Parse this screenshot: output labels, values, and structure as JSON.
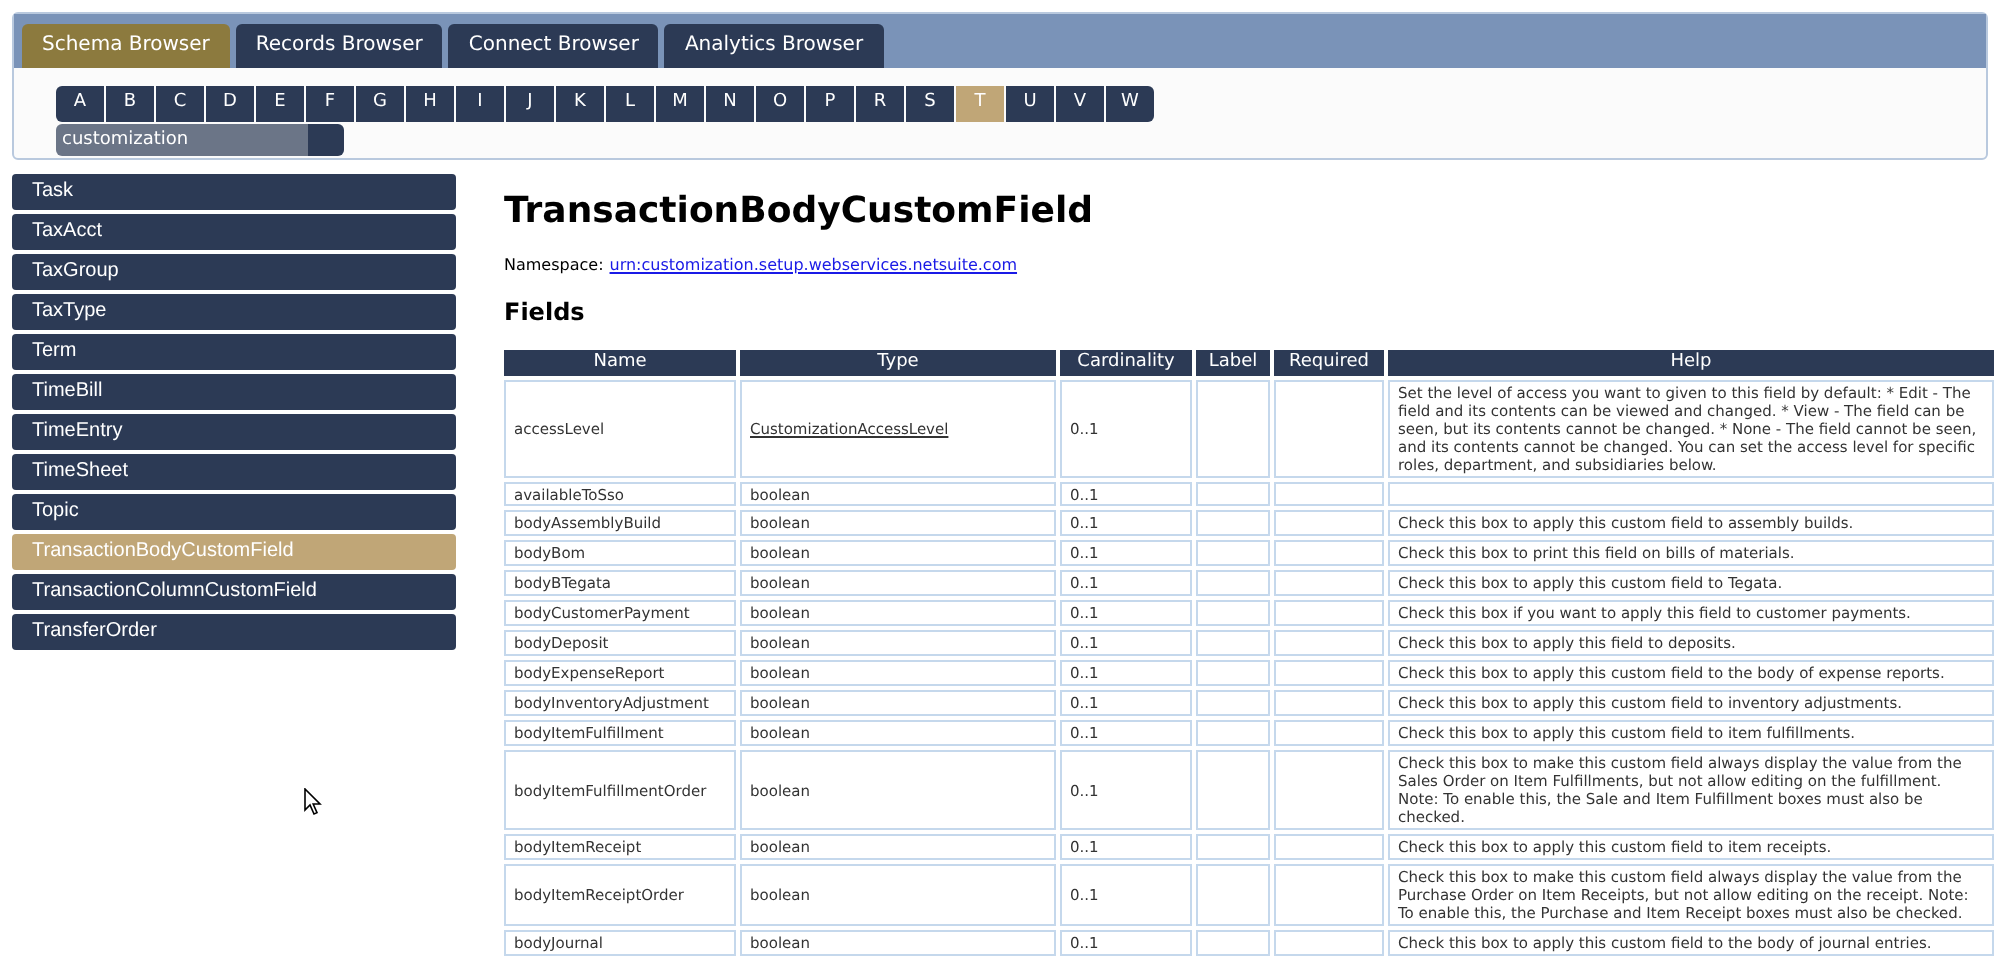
{
  "tabs": [
    {
      "label": "Schema Browser",
      "selected": true
    },
    {
      "label": "Records Browser",
      "selected": false
    },
    {
      "label": "Connect Browser",
      "selected": false
    },
    {
      "label": "Analytics Browser",
      "selected": false
    }
  ],
  "letters": [
    {
      "label": "A",
      "selected": false
    },
    {
      "label": "B",
      "selected": false
    },
    {
      "label": "C",
      "selected": false
    },
    {
      "label": "D",
      "selected": false
    },
    {
      "label": "E",
      "selected": false
    },
    {
      "label": "F",
      "selected": false
    },
    {
      "label": "G",
      "selected": false
    },
    {
      "label": "H",
      "selected": false
    },
    {
      "label": "I",
      "selected": false
    },
    {
      "label": "J",
      "selected": false
    },
    {
      "label": "K",
      "selected": false
    },
    {
      "label": "L",
      "selected": false
    },
    {
      "label": "M",
      "selected": false
    },
    {
      "label": "N",
      "selected": false
    },
    {
      "label": "O",
      "selected": false
    },
    {
      "label": "P",
      "selected": false
    },
    {
      "label": "R",
      "selected": false
    },
    {
      "label": "S",
      "selected": false
    },
    {
      "label": "T",
      "selected": true
    },
    {
      "label": "U",
      "selected": false
    },
    {
      "label": "V",
      "selected": false
    },
    {
      "label": "W",
      "selected": false
    }
  ],
  "namespace_filter": {
    "value": "customization"
  },
  "sidebar": {
    "items": [
      {
        "label": "Task",
        "selected": false
      },
      {
        "label": "TaxAcct",
        "selected": false
      },
      {
        "label": "TaxGroup",
        "selected": false
      },
      {
        "label": "TaxType",
        "selected": false
      },
      {
        "label": "Term",
        "selected": false
      },
      {
        "label": "TimeBill",
        "selected": false
      },
      {
        "label": "TimeEntry",
        "selected": false
      },
      {
        "label": "TimeSheet",
        "selected": false
      },
      {
        "label": "Topic",
        "selected": false
      },
      {
        "label": "TransactionBodyCustomField",
        "selected": true
      },
      {
        "label": "TransactionColumnCustomField",
        "selected": false
      },
      {
        "label": "TransferOrder",
        "selected": false
      }
    ]
  },
  "content": {
    "title": "TransactionBodyCustomField",
    "namespace_label": "Namespace:",
    "namespace_link": "urn:customization.setup.webservices.netsuite.com",
    "section_title": "Fields",
    "table": {
      "columns": [
        "Name",
        "Type",
        "Cardinality",
        "Label",
        "Required",
        "Help"
      ],
      "rows": [
        {
          "name": "accessLevel",
          "type": "CustomizationAccessLevel",
          "type_is_link": true,
          "cardinality": "0..1",
          "help": "Set the level of access you want to given to this field by default: * Edit - The field and its contents can be viewed and changed. * View - The field can be seen, but its contents cannot be changed. * None - The field cannot be seen, and its contents cannot be changed. You can set the access level for specific roles, department, and subsidiaries below."
        },
        {
          "name": "availableToSso",
          "type": "boolean",
          "type_is_link": false,
          "cardinality": "0..1"
        },
        {
          "name": "bodyAssemblyBuild",
          "type": "boolean",
          "type_is_link": false,
          "cardinality": "0..1",
          "help": "Check this box to apply this custom field to assembly builds."
        },
        {
          "name": "bodyBom",
          "type": "boolean",
          "type_is_link": false,
          "cardinality": "0..1",
          "help": "Check this box to print this field on bills of materials."
        },
        {
          "name": "bodyBTegata",
          "type": "boolean",
          "type_is_link": false,
          "cardinality": "0..1",
          "help": "Check this box to apply this custom field to Tegata."
        },
        {
          "name": "bodyCustomerPayment",
          "type": "boolean",
          "type_is_link": false,
          "cardinality": "0..1",
          "help": "Check this box if you want to apply this field to customer payments."
        },
        {
          "name": "bodyDeposit",
          "type": "boolean",
          "type_is_link": false,
          "cardinality": "0..1",
          "help": "Check this box to apply this field to deposits."
        },
        {
          "name": "bodyExpenseReport",
          "type": "boolean",
          "type_is_link": false,
          "cardinality": "0..1",
          "help": "Check this box to apply this custom field to the body of expense reports."
        },
        {
          "name": "bodyInventoryAdjustment",
          "type": "boolean",
          "type_is_link": false,
          "cardinality": "0..1",
          "help": "Check this box to apply this custom field to inventory adjustments."
        },
        {
          "name": "bodyItemFulfillment",
          "type": "boolean",
          "type_is_link": false,
          "cardinality": "0..1",
          "help": "Check this box to apply this custom field to item fulfillments."
        },
        {
          "name": "bodyItemFulfillmentOrder",
          "type": "boolean",
          "type_is_link": false,
          "cardinality": "0..1",
          "help": "Check this box to make this custom field always display the value from the Sales Order on Item Fulfillments, but not allow editing on the fulfillment. Note: To enable this, the Sale and Item Fulfillment boxes must also be checked."
        },
        {
          "name": "bodyItemReceipt",
          "type": "boolean",
          "type_is_link": false,
          "cardinality": "0..1",
          "help": "Check this box to apply this custom field to item receipts."
        },
        {
          "name": "bodyItemReceiptOrder",
          "type": "boolean",
          "type_is_link": false,
          "cardinality": "0..1",
          "help": "Check this box to make this custom field always display the value from the Purchase Order on Item Receipts, but not allow editing on the receipt. Note: To enable this, the Purchase and Item Receipt boxes must also be checked."
        },
        {
          "name": "bodyJournal",
          "type": "boolean",
          "type_is_link": false,
          "cardinality": "0..1",
          "help": "Check this box to apply this custom field to the body of journal entries."
        }
      ]
    }
  }
}
